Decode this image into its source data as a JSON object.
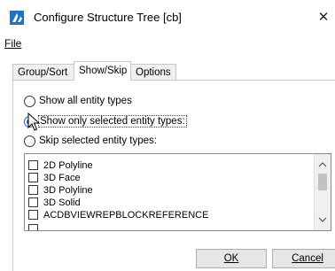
{
  "window": {
    "title": "Configure Structure Tree [cb]",
    "close_glyph": "✕",
    "app_icon": "app-logo-icon"
  },
  "menu": {
    "file": "File"
  },
  "tabs": [
    {
      "label": "Group/Sort",
      "active": false
    },
    {
      "label": "Show/Skip",
      "active": true
    },
    {
      "label": "Options",
      "active": false
    }
  ],
  "radios": [
    {
      "label": "Show all entity types",
      "selected": false
    },
    {
      "label": "Show only selected entity types:",
      "selected": true
    },
    {
      "label": "Skip selected entity types:",
      "selected": false
    }
  ],
  "list": {
    "items": [
      {
        "label": "2D Polyline",
        "checked": false
      },
      {
        "label": "3D Face",
        "checked": false
      },
      {
        "label": "3D Polyline",
        "checked": false
      },
      {
        "label": "3D Solid",
        "checked": false
      },
      {
        "label": "ACDBVIEWREPBLOCKREFERENCE",
        "checked": false
      }
    ]
  },
  "buttons": {
    "ok": "OK",
    "cancel": "Cancel"
  },
  "colors": {
    "accent": "#1a66c4",
    "border": "#adadad"
  }
}
